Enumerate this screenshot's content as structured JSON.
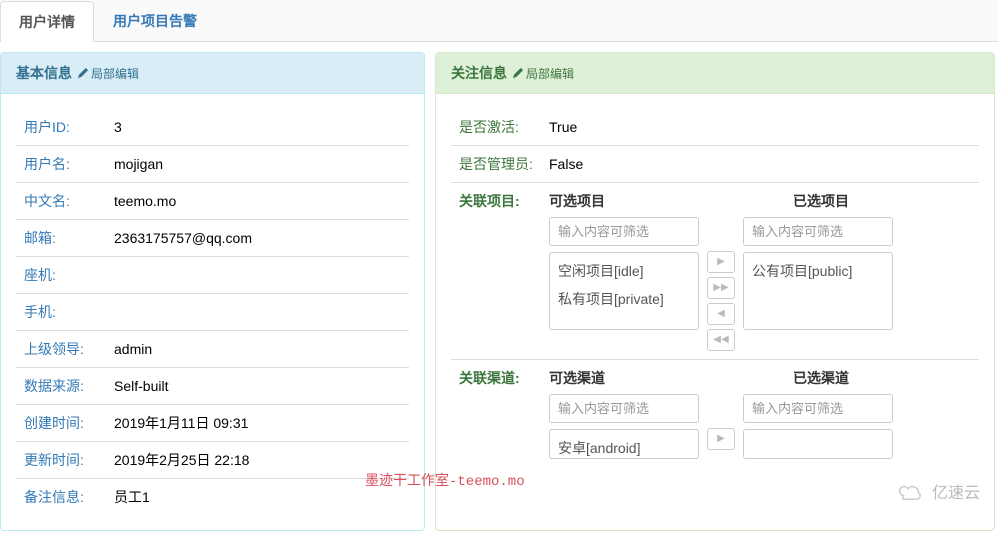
{
  "tabs": {
    "detail": "用户详情",
    "alarm": "用户项目告警"
  },
  "panel_left": {
    "title": "基本信息",
    "edit": "局部编辑",
    "rows": {
      "user_id": {
        "label": "用户ID:",
        "value": "3"
      },
      "username": {
        "label": "用户名:",
        "value": "mojigan"
      },
      "cn_name": {
        "label": "中文名:",
        "value": "teemo.mo"
      },
      "email": {
        "label": "邮箱:",
        "value": "2363175757@qq.com"
      },
      "landline": {
        "label": "座机:",
        "value": ""
      },
      "mobile": {
        "label": "手机:",
        "value": ""
      },
      "leader": {
        "label": "上级领导:",
        "value": "admin"
      },
      "source": {
        "label": "数据来源:",
        "value": "Self-built"
      },
      "created": {
        "label": "创建时间:",
        "value": "2019年1月11日 09:31"
      },
      "updated": {
        "label": "更新时间:",
        "value": "2019年2月25日 22:18"
      },
      "remark": {
        "label": "备注信息:",
        "value": "员工1"
      }
    }
  },
  "panel_right": {
    "title": "关注信息",
    "edit": "局部编辑",
    "active": {
      "label": "是否激活:",
      "value": "True"
    },
    "admin": {
      "label": "是否管理员:",
      "value": "False"
    },
    "proj": {
      "label": "关联项目:",
      "avail_head": "可选项目",
      "sel_head": "已选项目",
      "filter": "输入内容可筛选",
      "avail": {
        "0": "空闲项目[idle]",
        "1": "私有项目[private]"
      },
      "selected": {
        "0": "公有项目[public]"
      }
    },
    "chan": {
      "label": "关联渠道:",
      "avail_head": "可选渠道",
      "sel_head": "已选渠道",
      "filter": "输入内容可筛选",
      "avail": {
        "0": "安卓[android]"
      }
    }
  },
  "watermark": "墨迹干工作室-teemo.mo",
  "logo": "亿速云"
}
